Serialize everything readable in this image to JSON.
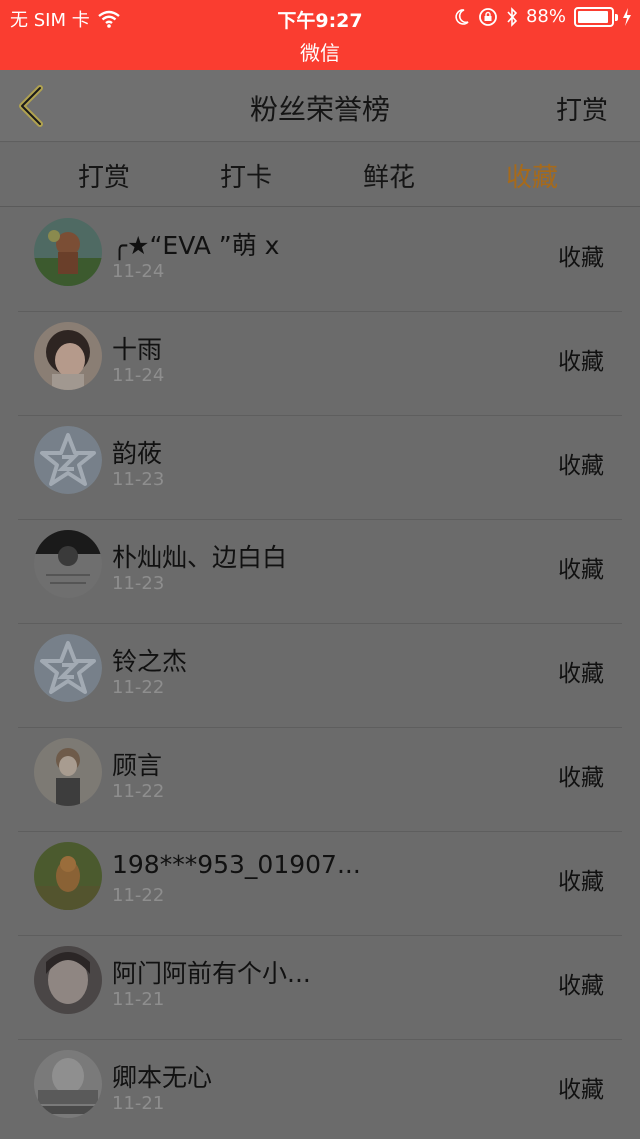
{
  "status_bar": {
    "carrier": "无 SIM 卡",
    "time": "下午9:27",
    "app": "微信",
    "battery": "88%",
    "icons": [
      "wifi-icon",
      "moon-icon",
      "lock-rotation-icon",
      "bluetooth-icon",
      "battery-icon",
      "charging-icon"
    ]
  },
  "nav": {
    "title": "粉丝荣誉榜",
    "right": "打赏",
    "back_icon": "chevron-left-icon"
  },
  "tabs": [
    {
      "label": "打赏",
      "active": false
    },
    {
      "label": "打卡",
      "active": false
    },
    {
      "label": "鲜花",
      "active": false
    },
    {
      "label": "收藏",
      "active": true
    }
  ],
  "colors": {
    "status_bar": "#fa3d30",
    "active_tab": "#a66a1b",
    "overlay_bg": "#6b6b6b"
  },
  "items": [
    {
      "name": "╭★“EVA ”萌 x",
      "date": "11-24",
      "action": "收藏",
      "avatar": "avatar-photo-game-character"
    },
    {
      "name": "十雨",
      "date": "11-24",
      "action": "收藏",
      "avatar": "avatar-photo-girl"
    },
    {
      "name": "韵莜",
      "date": "11-23",
      "action": "收藏",
      "avatar": "default-star-avatar-icon"
    },
    {
      "name": "朴灿灿、边白白",
      "date": "11-23",
      "action": "收藏",
      "avatar": "avatar-photo-poster"
    },
    {
      "name": "铃之杰",
      "date": "11-22",
      "action": "收藏",
      "avatar": "default-star-avatar-icon"
    },
    {
      "name": "顾言",
      "date": "11-22",
      "action": "收藏",
      "avatar": "avatar-photo-anime"
    },
    {
      "name": "198***953_01907...",
      "date": "11-22",
      "action": "收藏",
      "avatar": "avatar-photo-dog"
    },
    {
      "name": "阿门阿前有个小...",
      "date": "11-21",
      "action": "收藏",
      "avatar": "avatar-photo-boy"
    },
    {
      "name": "卿本无心",
      "date": "11-21",
      "action": "收藏",
      "avatar": "avatar-photo-text"
    }
  ]
}
